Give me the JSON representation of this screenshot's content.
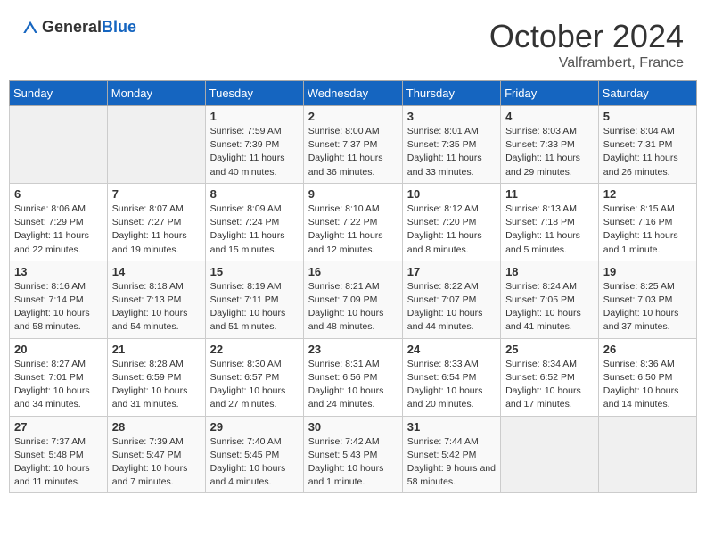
{
  "header": {
    "logo_general": "General",
    "logo_blue": "Blue",
    "month_title": "October 2024",
    "subtitle": "Valframbert, France"
  },
  "calendar": {
    "days_of_week": [
      "Sunday",
      "Monday",
      "Tuesday",
      "Wednesday",
      "Thursday",
      "Friday",
      "Saturday"
    ],
    "weeks": [
      [
        {
          "day": "",
          "info": ""
        },
        {
          "day": "",
          "info": ""
        },
        {
          "day": "1",
          "info": "Sunrise: 7:59 AM\nSunset: 7:39 PM\nDaylight: 11 hours and 40 minutes."
        },
        {
          "day": "2",
          "info": "Sunrise: 8:00 AM\nSunset: 7:37 PM\nDaylight: 11 hours and 36 minutes."
        },
        {
          "day": "3",
          "info": "Sunrise: 8:01 AM\nSunset: 7:35 PM\nDaylight: 11 hours and 33 minutes."
        },
        {
          "day": "4",
          "info": "Sunrise: 8:03 AM\nSunset: 7:33 PM\nDaylight: 11 hours and 29 minutes."
        },
        {
          "day": "5",
          "info": "Sunrise: 8:04 AM\nSunset: 7:31 PM\nDaylight: 11 hours and 26 minutes."
        }
      ],
      [
        {
          "day": "6",
          "info": "Sunrise: 8:06 AM\nSunset: 7:29 PM\nDaylight: 11 hours and 22 minutes."
        },
        {
          "day": "7",
          "info": "Sunrise: 8:07 AM\nSunset: 7:27 PM\nDaylight: 11 hours and 19 minutes."
        },
        {
          "day": "8",
          "info": "Sunrise: 8:09 AM\nSunset: 7:24 PM\nDaylight: 11 hours and 15 minutes."
        },
        {
          "day": "9",
          "info": "Sunrise: 8:10 AM\nSunset: 7:22 PM\nDaylight: 11 hours and 12 minutes."
        },
        {
          "day": "10",
          "info": "Sunrise: 8:12 AM\nSunset: 7:20 PM\nDaylight: 11 hours and 8 minutes."
        },
        {
          "day": "11",
          "info": "Sunrise: 8:13 AM\nSunset: 7:18 PM\nDaylight: 11 hours and 5 minutes."
        },
        {
          "day": "12",
          "info": "Sunrise: 8:15 AM\nSunset: 7:16 PM\nDaylight: 11 hours and 1 minute."
        }
      ],
      [
        {
          "day": "13",
          "info": "Sunrise: 8:16 AM\nSunset: 7:14 PM\nDaylight: 10 hours and 58 minutes."
        },
        {
          "day": "14",
          "info": "Sunrise: 8:18 AM\nSunset: 7:13 PM\nDaylight: 10 hours and 54 minutes."
        },
        {
          "day": "15",
          "info": "Sunrise: 8:19 AM\nSunset: 7:11 PM\nDaylight: 10 hours and 51 minutes."
        },
        {
          "day": "16",
          "info": "Sunrise: 8:21 AM\nSunset: 7:09 PM\nDaylight: 10 hours and 48 minutes."
        },
        {
          "day": "17",
          "info": "Sunrise: 8:22 AM\nSunset: 7:07 PM\nDaylight: 10 hours and 44 minutes."
        },
        {
          "day": "18",
          "info": "Sunrise: 8:24 AM\nSunset: 7:05 PM\nDaylight: 10 hours and 41 minutes."
        },
        {
          "day": "19",
          "info": "Sunrise: 8:25 AM\nSunset: 7:03 PM\nDaylight: 10 hours and 37 minutes."
        }
      ],
      [
        {
          "day": "20",
          "info": "Sunrise: 8:27 AM\nSunset: 7:01 PM\nDaylight: 10 hours and 34 minutes."
        },
        {
          "day": "21",
          "info": "Sunrise: 8:28 AM\nSunset: 6:59 PM\nDaylight: 10 hours and 31 minutes."
        },
        {
          "day": "22",
          "info": "Sunrise: 8:30 AM\nSunset: 6:57 PM\nDaylight: 10 hours and 27 minutes."
        },
        {
          "day": "23",
          "info": "Sunrise: 8:31 AM\nSunset: 6:56 PM\nDaylight: 10 hours and 24 minutes."
        },
        {
          "day": "24",
          "info": "Sunrise: 8:33 AM\nSunset: 6:54 PM\nDaylight: 10 hours and 20 minutes."
        },
        {
          "day": "25",
          "info": "Sunrise: 8:34 AM\nSunset: 6:52 PM\nDaylight: 10 hours and 17 minutes."
        },
        {
          "day": "26",
          "info": "Sunrise: 8:36 AM\nSunset: 6:50 PM\nDaylight: 10 hours and 14 minutes."
        }
      ],
      [
        {
          "day": "27",
          "info": "Sunrise: 7:37 AM\nSunset: 5:48 PM\nDaylight: 10 hours and 11 minutes."
        },
        {
          "day": "28",
          "info": "Sunrise: 7:39 AM\nSunset: 5:47 PM\nDaylight: 10 hours and 7 minutes."
        },
        {
          "day": "29",
          "info": "Sunrise: 7:40 AM\nSunset: 5:45 PM\nDaylight: 10 hours and 4 minutes."
        },
        {
          "day": "30",
          "info": "Sunrise: 7:42 AM\nSunset: 5:43 PM\nDaylight: 10 hours and 1 minute."
        },
        {
          "day": "31",
          "info": "Sunrise: 7:44 AM\nSunset: 5:42 PM\nDaylight: 9 hours and 58 minutes."
        },
        {
          "day": "",
          "info": ""
        },
        {
          "day": "",
          "info": ""
        }
      ]
    ]
  }
}
